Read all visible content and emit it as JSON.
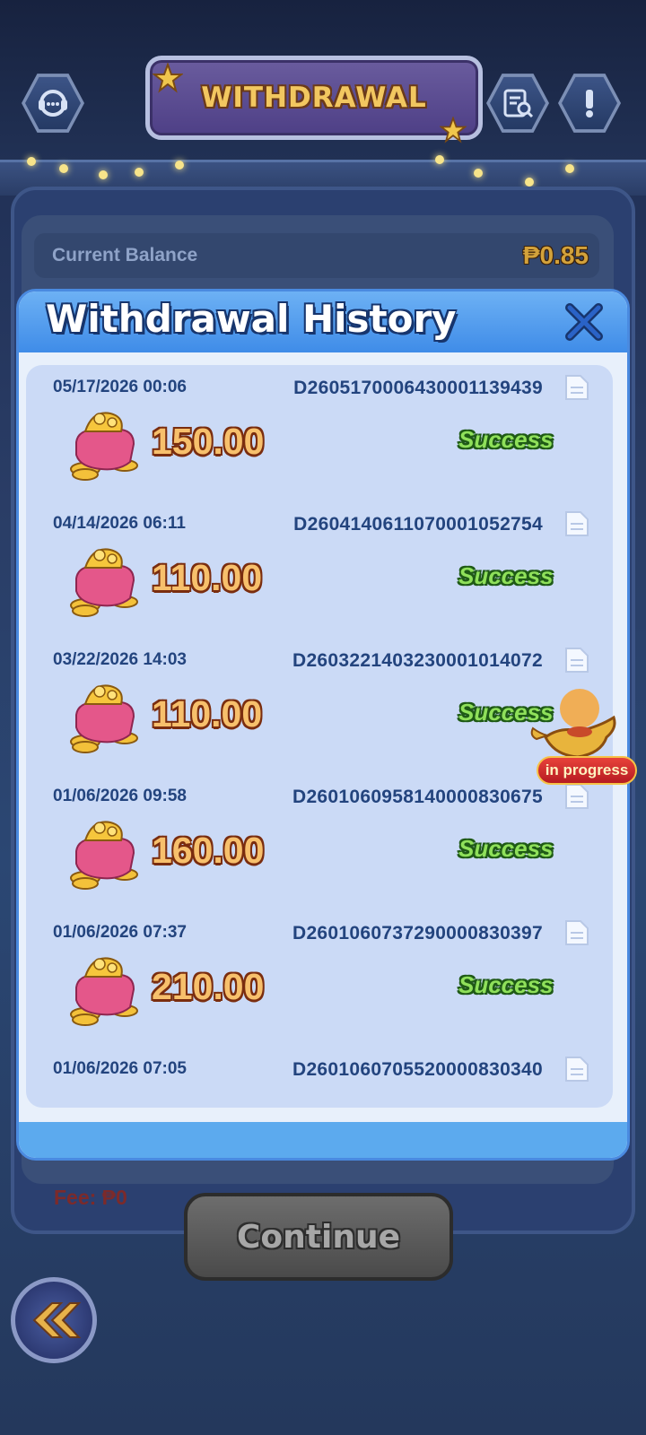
{
  "header": {
    "title": "WITHDRAWAL",
    "left_icon": "support-chat-icon",
    "right_icons": [
      "record-search-icon",
      "exclamation-info-icon"
    ]
  },
  "balance": {
    "label": "Current Balance",
    "value": "₱0.85"
  },
  "modal": {
    "title": "Withdrawal History",
    "close_icon": "close-x-icon",
    "records": [
      {
        "date": "05/17/2026 00:06",
        "id": "D2605170006430001139439",
        "amount": "150.00",
        "status": "Success"
      },
      {
        "date": "04/14/2026 06:11",
        "id": "D2604140611070001052754",
        "amount": "110.00",
        "status": "Success"
      },
      {
        "date": "03/22/2026 14:03",
        "id": "D2603221403230001014072",
        "amount": "110.00",
        "status": "Success"
      },
      {
        "date": "01/06/2026 09:58",
        "id": "D2601060958140000830675",
        "amount": "160.00",
        "status": "Success"
      },
      {
        "date": "01/06/2026 07:37",
        "id": "D2601060737290000830397",
        "amount": "210.00",
        "status": "Success"
      },
      {
        "date": "01/06/2026 07:05",
        "id": "D2601060705520000830340",
        "amount": "",
        "status": ""
      }
    ]
  },
  "fee": "Fee: ₱0",
  "continue_button": "Continue",
  "progress_badge": "in progress",
  "colors": {
    "modal_header": "#4f9cee",
    "success_green": "#8fe05a",
    "amount_orange": "#f7c06c",
    "id_text": "#23447e"
  }
}
